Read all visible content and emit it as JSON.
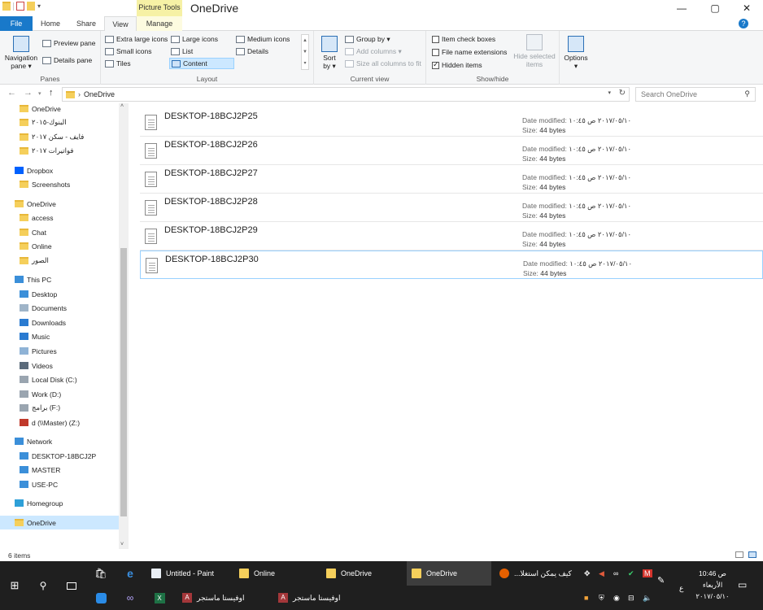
{
  "window": {
    "title": "OneDrive",
    "context_tab_label": "Picture Tools",
    "minimize": "—",
    "maximize": "▢",
    "close": "✕",
    "help": "?"
  },
  "tabs": {
    "file": "File",
    "home": "Home",
    "share": "Share",
    "view": "View",
    "manage": "Manage"
  },
  "ribbon": {
    "panes": {
      "label": "Panes",
      "navigation_pane": "Navigation",
      "navigation_pane_2": "pane ▾",
      "preview_pane": "Preview pane",
      "details_pane": "Details pane"
    },
    "layout": {
      "label": "Layout",
      "extra_large_icons": "Extra large icons",
      "large_icons": "Large icons",
      "medium_icons": "Medium icons",
      "small_icons": "Small icons",
      "list": "List",
      "details": "Details",
      "tiles": "Tiles",
      "content": "Content"
    },
    "current_view": {
      "label": "Current view",
      "sort_by": "Sort",
      "sort_by_2": "by ▾",
      "group_by": "Group by ▾",
      "add_columns": "Add columns ▾",
      "size_all_columns": "Size all columns to fit"
    },
    "show_hide": {
      "label": "Show/hide",
      "item_check_boxes": "Item check boxes",
      "file_name_extensions": "File name extensions",
      "hidden_items": "Hidden items",
      "item_check_boxes_checked": false,
      "file_name_extensions_checked": false,
      "hidden_items_checked": true,
      "hide_selected": "Hide selected",
      "hide_selected_2": "items"
    },
    "options": {
      "label": "Options",
      "arrow": "▾"
    }
  },
  "address": {
    "path": "OneDrive",
    "separator": "›",
    "search_placeholder": "Search OneDrive"
  },
  "nav_items": [
    {
      "label": "OneDrive",
      "icon": "folder-icon",
      "indent": 1
    },
    {
      "label": "البنوك-٢٠١٥",
      "icon": "folder-icon",
      "indent": 1
    },
    {
      "label": "فايف - سكن ٢٠١٧",
      "icon": "folder-icon",
      "indent": 1
    },
    {
      "label": "فواتيرات ٢٠١٧",
      "icon": "folder-icon",
      "indent": 1
    },
    {
      "label": "Dropbox",
      "icon": "dropbox-icon",
      "indent": 0
    },
    {
      "label": "Screenshots",
      "icon": "folder-icon",
      "indent": 1
    },
    {
      "label": "OneDrive",
      "icon": "folder-icon",
      "indent": 0
    },
    {
      "label": "access",
      "icon": "folder-icon",
      "indent": 1
    },
    {
      "label": "Chat",
      "icon": "folder-icon",
      "indent": 1
    },
    {
      "label": "Online",
      "icon": "folder-icon",
      "indent": 1
    },
    {
      "label": "الصور",
      "icon": "folder-icon",
      "indent": 1
    },
    {
      "label": "This PC",
      "icon": "computer-icon",
      "indent": 0
    },
    {
      "label": "Desktop",
      "icon": "desktop-icon",
      "indent": 1
    },
    {
      "label": "Documents",
      "icon": "documents-icon",
      "indent": 1
    },
    {
      "label": "Downloads",
      "icon": "downloads-icon",
      "indent": 1
    },
    {
      "label": "Music",
      "icon": "music-icon",
      "indent": 1
    },
    {
      "label": "Pictures",
      "icon": "pictures-icon",
      "indent": 1
    },
    {
      "label": "Videos",
      "icon": "videos-icon",
      "indent": 1
    },
    {
      "label": "Local Disk (C:)",
      "icon": "drive-icon",
      "indent": 1
    },
    {
      "label": "Work (D:)",
      "icon": "drive-icon",
      "indent": 1
    },
    {
      "label": "برامج (F:)",
      "icon": "drive-icon",
      "indent": 1
    },
    {
      "label": "d (\\\\Master) (Z:)",
      "icon": "network-drive-icon",
      "indent": 1
    },
    {
      "label": "Network",
      "icon": "network-icon",
      "indent": 0
    },
    {
      "label": "DESKTOP-18BCJ2P",
      "icon": "computer-icon",
      "indent": 1
    },
    {
      "label": "MASTER",
      "icon": "computer-icon",
      "indent": 1
    },
    {
      "label": "USE-PC",
      "icon": "computer-icon",
      "indent": 1
    },
    {
      "label": "Homegroup",
      "icon": "homegroup-icon",
      "indent": 0
    },
    {
      "label": "OneDrive",
      "icon": "folder-icon",
      "indent": 0
    }
  ],
  "files": [
    {
      "name": "DESKTOP-18BCJ2P25",
      "date_label": "Date modified:",
      "date": "٢٠١٧/٠٥/١٠ ص ١٠:٤٥",
      "size_label": "Size:",
      "size": "44 bytes"
    },
    {
      "name": "DESKTOP-18BCJ2P26",
      "date_label": "Date modified:",
      "date": "٢٠١٧/٠٥/١٠ ص ١٠:٤٥",
      "size_label": "Size:",
      "size": "44 bytes"
    },
    {
      "name": "DESKTOP-18BCJ2P27",
      "date_label": "Date modified:",
      "date": "٢٠١٧/٠٥/١٠ ص ١٠:٤٥",
      "size_label": "Size:",
      "size": "44 bytes"
    },
    {
      "name": "DESKTOP-18BCJ2P28",
      "date_label": "Date modified:",
      "date": "٢٠١٧/٠٥/١٠ ص ١٠:٤٥",
      "size_label": "Size:",
      "size": "44 bytes"
    },
    {
      "name": "DESKTOP-18BCJ2P29",
      "date_label": "Date modified:",
      "date": "٢٠١٧/٠٥/١٠ ص ١٠:٤٥",
      "size_label": "Size:",
      "size": "44 bytes"
    },
    {
      "name": "DESKTOP-18BCJ2P30",
      "date_label": "Date modified:",
      "date": "٢٠١٧/٠٥/١٠ ص ١٠:٤٥",
      "size_label": "Size:",
      "size": "44 bytes"
    }
  ],
  "status": {
    "item_count": "6 items"
  },
  "taskbar": {
    "buttons": [
      {
        "label": "Untitled - Paint",
        "icon": "paint-icon"
      },
      {
        "label": "Online",
        "icon": "folder-icon"
      },
      {
        "label": "OneDrive",
        "icon": "folder-icon"
      },
      {
        "label": "OneDrive",
        "icon": "folder-icon"
      },
      {
        "label": "...كيف يمكن استغلا",
        "icon": "firefox-icon"
      }
    ],
    "row2_buttons": [
      {
        "label": "اوفيستا ماستجر",
        "icon": "access-icon"
      },
      {
        "label": "اوفيستا ماستجر",
        "icon": "access-icon"
      }
    ],
    "clock": {
      "time": "10:46 ص",
      "day": "الأربعاء",
      "date": "٢٠١٧/٠٥/١٠"
    },
    "lang": "ع"
  },
  "colors": {
    "file_tab": "#1979ca",
    "context_tab": "#f6f1a5",
    "selection": "#cce8ff",
    "taskbar": "#1f1f1f"
  }
}
